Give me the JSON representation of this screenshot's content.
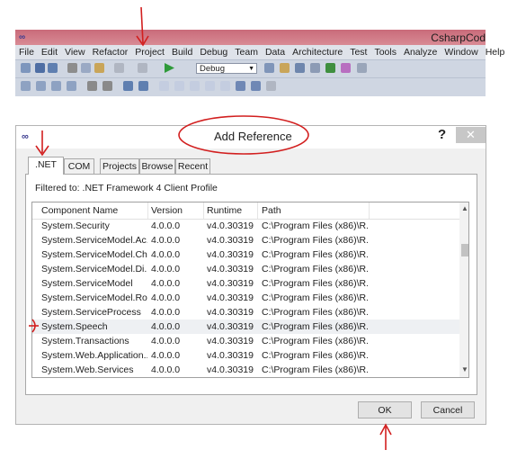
{
  "vs": {
    "logo": "∞",
    "app_name": "CsharpCod",
    "menu": [
      "File",
      "Edit",
      "View",
      "Refactor",
      "Project",
      "Build",
      "Debug",
      "Team",
      "Data",
      "Architecture",
      "Test",
      "Tools",
      "Analyze",
      "Window",
      "Help"
    ],
    "config_combo": "Debug"
  },
  "dialog": {
    "logo": "∞",
    "title": "Add Reference",
    "help": "?",
    "close": "✕",
    "tabs": [
      ".NET",
      "COM",
      "Projects",
      "Browse",
      "Recent"
    ],
    "filter_text": "Filtered to: .NET Framework 4 Client Profile",
    "columns": [
      "Component Name",
      "Version",
      "Runtime",
      "Path"
    ],
    "rows": [
      {
        "name": "System.Security",
        "version": "4.0.0.0",
        "runtime": "v4.0.30319",
        "path": "C:\\Program Files (x86)\\R..."
      },
      {
        "name": "System.ServiceModel.Ac...",
        "version": "4.0.0.0",
        "runtime": "v4.0.30319",
        "path": "C:\\Program Files (x86)\\R..."
      },
      {
        "name": "System.ServiceModel.Ch...",
        "version": "4.0.0.0",
        "runtime": "v4.0.30319",
        "path": "C:\\Program Files (x86)\\R..."
      },
      {
        "name": "System.ServiceModel.Di...",
        "version": "4.0.0.0",
        "runtime": "v4.0.30319",
        "path": "C:\\Program Files (x86)\\R..."
      },
      {
        "name": "System.ServiceModel",
        "version": "4.0.0.0",
        "runtime": "v4.0.30319",
        "path": "C:\\Program Files (x86)\\R..."
      },
      {
        "name": "System.ServiceModel.Ro...",
        "version": "4.0.0.0",
        "runtime": "v4.0.30319",
        "path": "C:\\Program Files (x86)\\R..."
      },
      {
        "name": "System.ServiceProcess",
        "version": "4.0.0.0",
        "runtime": "v4.0.30319",
        "path": "C:\\Program Files (x86)\\R..."
      },
      {
        "name": "System.Speech",
        "version": "4.0.0.0",
        "runtime": "v4.0.30319",
        "path": "C:\\Program Files (x86)\\R..."
      },
      {
        "name": "System.Transactions",
        "version": "4.0.0.0",
        "runtime": "v4.0.30319",
        "path": "C:\\Program Files (x86)\\R..."
      },
      {
        "name": "System.Web.Application...",
        "version": "4.0.0.0",
        "runtime": "v4.0.30319",
        "path": "C:\\Program Files (x86)\\R..."
      },
      {
        "name": "System.Web.Services",
        "version": "4.0.0.0",
        "runtime": "v4.0.30319",
        "path": "C:\\Program Files (x86)\\R..."
      }
    ],
    "ok_label": "OK",
    "cancel_label": "Cancel"
  },
  "colors": {
    "annotation": "#d21f1f",
    "title_strip": "#c96b7a"
  }
}
